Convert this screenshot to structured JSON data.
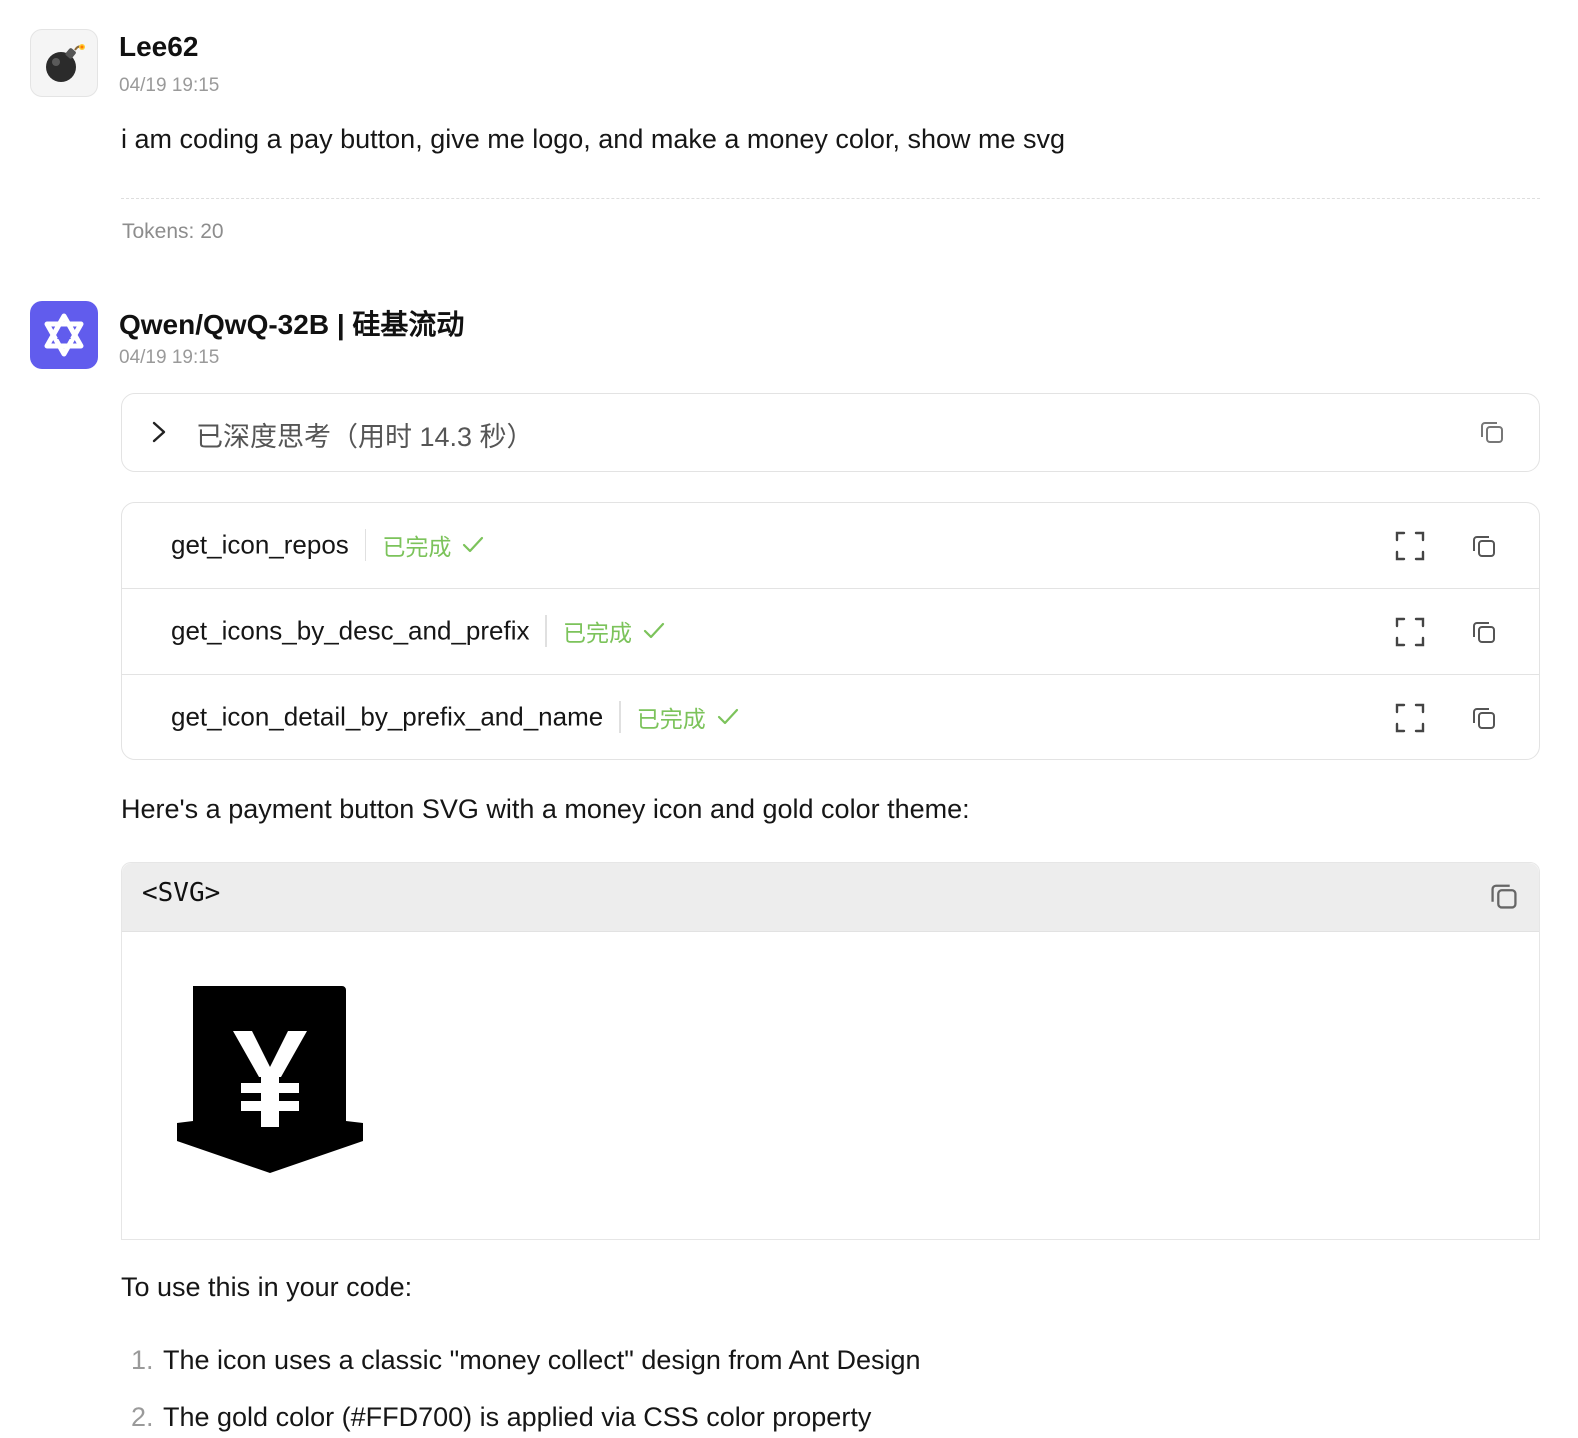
{
  "user_message": {
    "author": "Lee62",
    "time": "04/19 19:15",
    "avatar_icon": "bomb-emoji-icon",
    "text": "i am coding a pay button, give me logo, and make a money color, show me svg",
    "tokens": "Tokens: 20"
  },
  "assistant_message": {
    "author": "Qwen/QwQ-32B | 硅基流动",
    "time": "04/19 19:15",
    "avatar_icon": "qwen-logo-icon",
    "avatar_color": "#615ced",
    "thinking_label": "已深度思考（用时 14.3 秒）",
    "tool_calls": [
      {
        "name": "get_icon_repos",
        "status": "已完成"
      },
      {
        "name": "get_icons_by_desc_and_prefix",
        "status": "已完成"
      },
      {
        "name": "get_icon_detail_by_prefix_and_name",
        "status": "已完成"
      }
    ],
    "status_color": "#7cc35b",
    "intro_text": "Here's a payment button SVG with a money icon and gold color theme:",
    "code_block": {
      "language": "<SVG>",
      "preview_icon": "money-collect-icon"
    },
    "usage_heading": "To use this in your code:",
    "list": [
      {
        "num": "1.",
        "text": "The icon uses a classic \"money collect\" design from Ant Design"
      },
      {
        "num": "2.",
        "text": "The gold color (#FFD700) is applied via CSS color property"
      }
    ]
  }
}
